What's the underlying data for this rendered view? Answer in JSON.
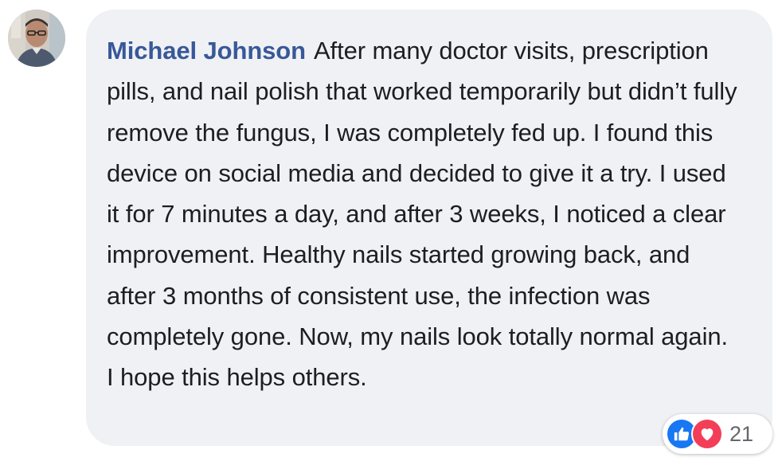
{
  "comment": {
    "author_name": "Michael Johnson",
    "text": "After many doctor visits, prescription pills, and nail polish that worked temporarily but didn’t fully remove the fungus, I was completely fed up. I found this device on social media and decided to give it a try. I used it for 7 minutes a day, and after 3 weeks, I noticed a clear improvement. Healthy nails started growing back, and after 3 months of consistent use, the infection was completely gone. Now, my nails look totally normal again. I hope this helps others."
  },
  "reactions": {
    "icons": [
      "like-icon",
      "love-icon"
    ],
    "count": "21"
  },
  "colors": {
    "author": "#385898",
    "bubble": "#eff1f4",
    "text": "#1c1e21",
    "like": "#1877f2",
    "love": "#f33e58",
    "count": "#65676b"
  }
}
